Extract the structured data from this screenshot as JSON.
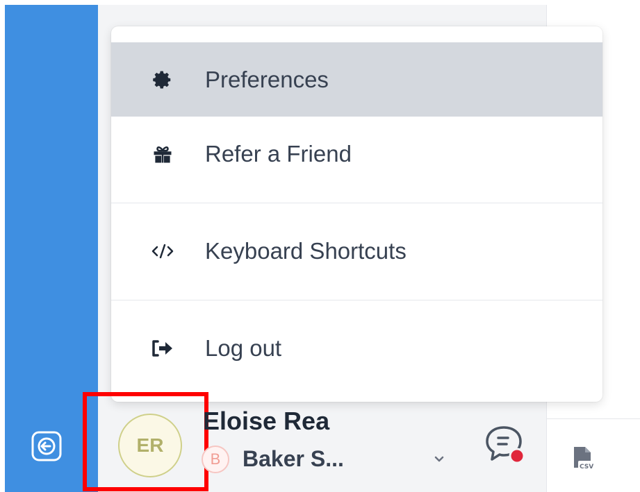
{
  "menu": {
    "items": [
      {
        "label": "Preferences",
        "icon": "gear-icon"
      },
      {
        "label": "Refer a Friend",
        "icon": "gift-icon"
      },
      {
        "label": "Keyboard Shortcuts",
        "icon": "code-icon"
      },
      {
        "label": "Log out",
        "icon": "logout-icon"
      }
    ]
  },
  "user": {
    "initials": "ER",
    "name": "Eloise Rea",
    "org_badge": "B",
    "org_name": "Baker S..."
  },
  "icons": {
    "collapse": "arrow-left-circle-icon",
    "chevron": "chevron-down-icon",
    "chat": "chat-notification-icon",
    "csv": "csv-file-icon"
  },
  "colors": {
    "rail": "#3f8fe1",
    "selected_item": "#d4d8de",
    "highlight": "#ff0000",
    "notification_dot": "#e0263b"
  }
}
